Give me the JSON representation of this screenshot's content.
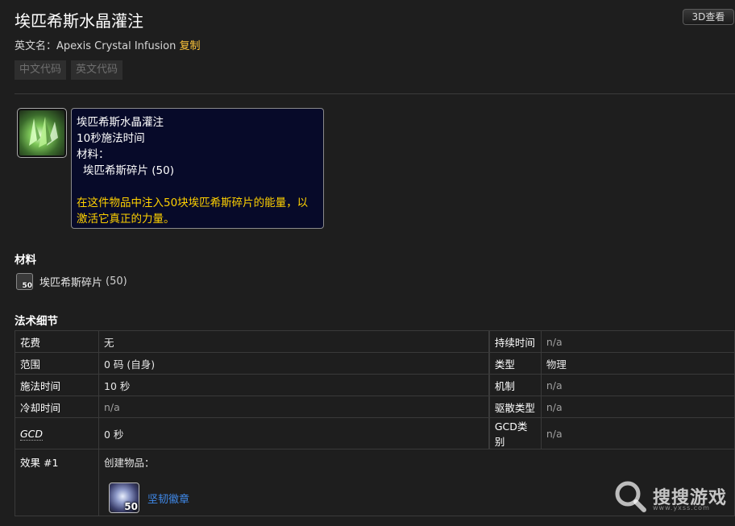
{
  "header": {
    "title": "埃匹希斯水晶灌注",
    "view3d_label": "3D查看",
    "english_name_label": "英文名：",
    "english_name": "Apexis Crystal Infusion",
    "copy_label": "复制"
  },
  "code_buttons": {
    "chinese": "中文代码",
    "english": "英文代码"
  },
  "tooltip": {
    "name": "埃匹希斯水晶灌注",
    "cast_time": "10秒施法时间",
    "materials_label": "材料：",
    "material_line": "埃匹希斯碎片 (50)",
    "description": "在这件物品中注入50块埃匹希斯碎片的能量，以激活它真正的力量。"
  },
  "materials": {
    "heading": "材料",
    "item_name": "埃匹希斯碎片",
    "item_count": "(50)",
    "icon_count": "50"
  },
  "spell_details": {
    "heading": "法术细节",
    "rows": [
      {
        "label": "花费",
        "value": "无",
        "label2": "持续时间",
        "value2": "n/a"
      },
      {
        "label": "范围",
        "value": "0 码 (自身)",
        "label2": "类型",
        "value2": "物理"
      },
      {
        "label": "施法时间",
        "value": "10 秒",
        "label2": "机制",
        "value2": "n/a"
      },
      {
        "label": "冷却时间",
        "value": "n/a",
        "label2": "驱散类型",
        "value2": "n/a"
      },
      {
        "label": "GCD",
        "value": "0 秒",
        "label2": "GCD类别",
        "value2": "n/a"
      }
    ],
    "effect": {
      "label": "效果 #1",
      "text": "创建物品：",
      "item_name": "坚韧徽章",
      "item_count": "50"
    }
  },
  "watermark": {
    "text": "搜搜游戏",
    "url": "www.yxss.com"
  },
  "colors": {
    "background": "#1e1e1e",
    "gold": "#ffd100",
    "link_blue": "#3f88e8",
    "tooltip_bg": "#070a29"
  }
}
